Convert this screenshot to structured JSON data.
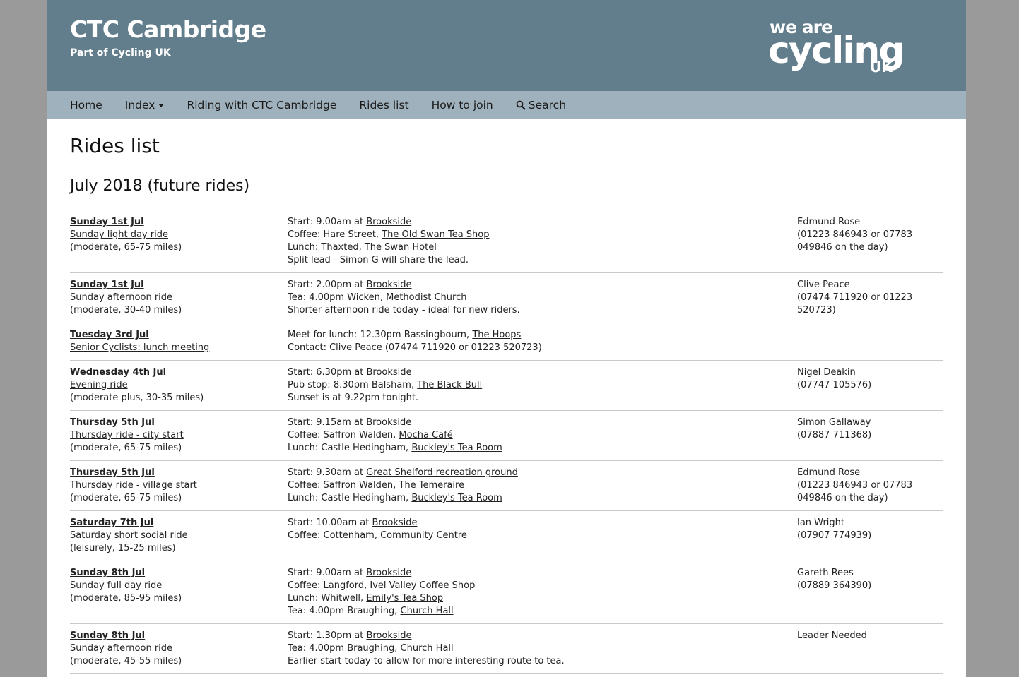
{
  "header": {
    "title": "CTC Cambridge",
    "subtitle": "Part of Cycling UK",
    "logo": {
      "line1": "we are",
      "line2": "cycling",
      "line3": "UK"
    }
  },
  "nav": {
    "items": [
      "Home",
      "Index",
      "Riding with CTC Cambridge",
      "Rides list",
      "How to join",
      "Search"
    ]
  },
  "page_title": "Rides list",
  "month_heading": "July 2018 (future rides)",
  "rides": [
    {
      "date": "Sunday 1st Jul",
      "name": "Sunday light day ride",
      "grade": "(moderate, 65-75 miles)",
      "details": [
        {
          "prefix": "Start: 9.00am at ",
          "link": "Brookside"
        },
        {
          "prefix": "Coffee: Hare Street, ",
          "link": "The Old Swan Tea Shop"
        },
        {
          "prefix": "Lunch: Thaxted, ",
          "link": "The Swan Hotel"
        },
        {
          "prefix": "Split lead - Simon G will share the lead.",
          "link": ""
        }
      ],
      "leader": [
        "Edmund Rose",
        "(01223 846943 or 07783",
        "049846 on the day)"
      ]
    },
    {
      "date": "Sunday 1st Jul",
      "name": "Sunday afternoon ride",
      "grade": "(moderate, 30-40 miles)",
      "details": [
        {
          "prefix": "Start: 2.00pm at ",
          "link": "Brookside"
        },
        {
          "prefix": "Tea: 4.00pm Wicken, ",
          "link": "Methodist Church"
        },
        {
          "prefix": "Shorter afternoon ride today - ideal for new riders.",
          "link": ""
        }
      ],
      "leader": [
        "Clive Peace",
        "(07474 711920 or 01223",
        "520723)"
      ]
    },
    {
      "date": "Tuesday 3rd Jul",
      "name": "Senior Cyclists: lunch meeting",
      "grade": "",
      "details": [
        {
          "prefix": "Meet for lunch: 12.30pm Bassingbourn, ",
          "link": "The Hoops"
        },
        {
          "prefix": "Contact: Clive Peace (07474 711920 or 01223 520723)",
          "link": ""
        }
      ],
      "leader": []
    },
    {
      "date": "Wednesday 4th Jul",
      "name": "Evening ride",
      "grade": "(moderate plus, 30-35 miles)",
      "details": [
        {
          "prefix": "Start: 6.30pm at ",
          "link": "Brookside"
        },
        {
          "prefix": "Pub stop: 8.30pm Balsham, ",
          "link": "The Black Bull"
        },
        {
          "prefix": "Sunset is at 9.22pm tonight.",
          "link": ""
        }
      ],
      "leader": [
        "Nigel Deakin",
        "(07747 105576)"
      ]
    },
    {
      "date": "Thursday 5th Jul",
      "name": "Thursday ride - city start",
      "grade": "(moderate, 65-75 miles)",
      "details": [
        {
          "prefix": "Start: 9.15am at ",
          "link": "Brookside"
        },
        {
          "prefix": "Coffee: Saffron Walden, ",
          "link": "Mocha Café"
        },
        {
          "prefix": "Lunch: Castle Hedingham, ",
          "link": "Buckley's Tea Room"
        }
      ],
      "leader": [
        "Simon Gallaway",
        "(07887 711368)"
      ]
    },
    {
      "date": "Thursday 5th Jul",
      "name": "Thursday ride - village start",
      "grade": "(moderate, 65-75 miles)",
      "details": [
        {
          "prefix": "Start: 9.30am at ",
          "link": "Great Shelford recreation ground"
        },
        {
          "prefix": "Coffee: Saffron Walden, ",
          "link": "The Temeraire"
        },
        {
          "prefix": "Lunch: Castle Hedingham, ",
          "link": "Buckley's Tea Room"
        }
      ],
      "leader": [
        "Edmund Rose",
        "(01223 846943 or 07783",
        "049846 on the day)"
      ]
    },
    {
      "date": "Saturday 7th Jul",
      "name": "Saturday short social ride",
      "grade": "(leisurely, 15-25 miles)",
      "details": [
        {
          "prefix": "Start: 10.00am at ",
          "link": "Brookside"
        },
        {
          "prefix": "Coffee: Cottenham, ",
          "link": "Community Centre"
        }
      ],
      "leader": [
        "Ian Wright",
        "(07907 774939)"
      ]
    },
    {
      "date": "Sunday 8th Jul",
      "name": "Sunday full day ride",
      "grade": "(moderate, 85-95 miles)",
      "details": [
        {
          "prefix": "Start: 9.00am at ",
          "link": "Brookside"
        },
        {
          "prefix": "Coffee: Langford, ",
          "link": "Ivel Valley Coffee Shop"
        },
        {
          "prefix": "Lunch: Whitwell, ",
          "link": "Emily's Tea Shop"
        },
        {
          "prefix": "Tea: 4.00pm Braughing, ",
          "link": "Church Hall"
        }
      ],
      "leader": [
        "Gareth Rees",
        "(07889 364390)"
      ]
    },
    {
      "date": "Sunday 8th Jul",
      "name": "Sunday afternoon ride",
      "grade": "(moderate, 45-55 miles)",
      "details": [
        {
          "prefix": "Start: 1.30pm at ",
          "link": "Brookside"
        },
        {
          "prefix": "Tea: 4.00pm Braughing, ",
          "link": "Church Hall"
        },
        {
          "prefix": "Earlier start today to allow for more interesting route to tea.",
          "link": ""
        }
      ],
      "leader": [
        "Leader Needed"
      ]
    }
  ]
}
